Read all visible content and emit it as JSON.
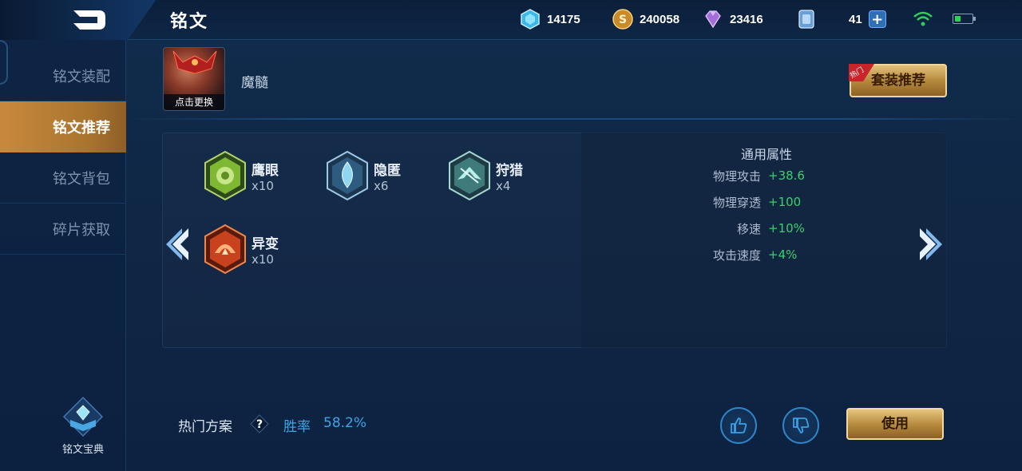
{
  "header": {
    "title": "铭文",
    "currencies": [
      {
        "icon": "diamond-icon",
        "value": "14175"
      },
      {
        "icon": "gold-coin-icon",
        "value": "240058"
      },
      {
        "icon": "purple-gem-icon",
        "value": "23416"
      },
      {
        "icon": "ticket-icon",
        "value": "41"
      }
    ],
    "status": {
      "wifi": "wifi-icon",
      "battery_level": 0.3
    }
  },
  "sidebar": {
    "items": [
      {
        "label": "铭文装配",
        "active": false
      },
      {
        "label": "铭文推荐",
        "active": true
      },
      {
        "label": "铭文背包",
        "active": false
      },
      {
        "label": "碎片获取",
        "active": false
      }
    ],
    "book_label": "铭文宝典"
  },
  "hero": {
    "change_label": "点击更换",
    "name": "魔髓",
    "set_recommend_label": "套装推荐",
    "hot_tag": "热门"
  },
  "runes": [
    {
      "name": "鹰眼",
      "count": "x10",
      "color": "#8cc63f"
    },
    {
      "name": "隐匿",
      "count": "x6",
      "color": "#5ab7e0"
    },
    {
      "name": "狩猎",
      "count": "x4",
      "color": "#6fc7c0"
    },
    {
      "name": "异变",
      "count": "x10",
      "color": "#e0512a"
    }
  ],
  "attributes": {
    "title": "通用属性",
    "rows": [
      {
        "label": "物理攻击",
        "value": "+38.6"
      },
      {
        "label": "物理穿透",
        "value": "+100"
      },
      {
        "label": "移速",
        "value": "+10%"
      },
      {
        "label": "攻击速度",
        "value": "+4%"
      }
    ]
  },
  "footer": {
    "plan_label": "热门方案",
    "help": "?",
    "win_rate_label": "胜率",
    "win_rate_value": "58.2%",
    "use_label": "使用"
  },
  "colors": {
    "accent_gold": "#c9893c",
    "stat_green": "#38d06b",
    "win_blue": "#3aa7e6",
    "background": "#0f2847"
  }
}
